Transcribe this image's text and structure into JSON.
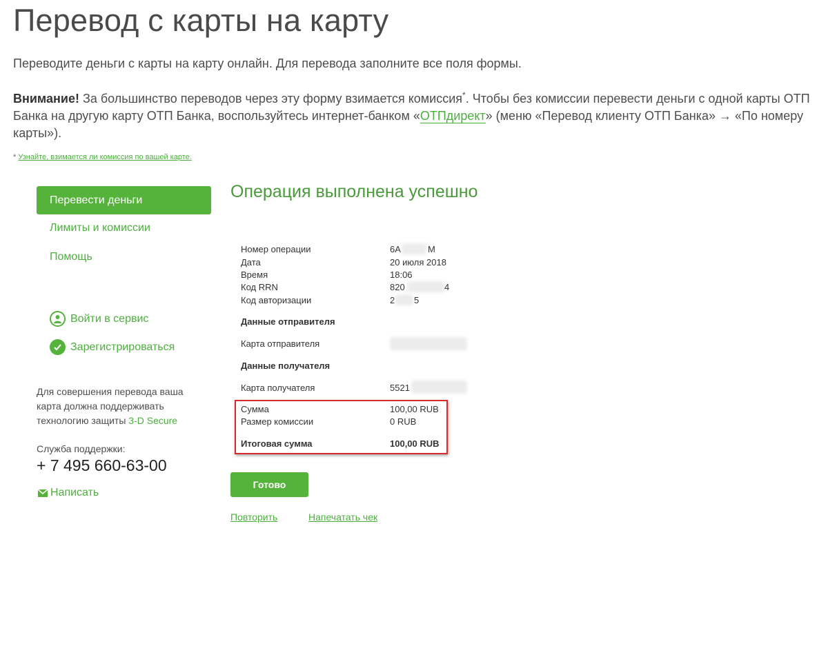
{
  "header": {
    "title": "Перевод с карты на карту",
    "intro": "Переводите деньги с карты на карту онлайн. Для перевода заполните все поля формы.",
    "notice_bold": "Внимание!",
    "notice_part1": " За большинство переводов через эту форму взимается комиссия",
    "notice_sup": "*",
    "notice_part2": ". Чтобы без комиссии перевести деньги с одной карты ОТП Банка на другую карту ОТП Банка, воспользуйтесь интернет-банком «",
    "notice_link": "ОТПдирект",
    "notice_part3": "» (меню «Перевод клиенту ОТП Банка» → «По номеру карты»).",
    "footnote_star": "*",
    "footnote_link": "Узнайте, взимается ли комиссия по вашей карте."
  },
  "sidebar": {
    "items": [
      {
        "label": "Перевести деньги"
      },
      {
        "label": "Лимиты и комиссии"
      },
      {
        "label": "Помощь"
      }
    ],
    "login": "Войти в сервис",
    "register": "Зарегистрироваться",
    "secure_text": "Для совершения перевода ваша карта должна поддерживать технологию защиты",
    "secure_link": "3-D Secure",
    "support_label": "Служба поддержки:",
    "phone": "+ 7 495 660-63-00",
    "write": "Написать"
  },
  "result": {
    "title": "Операция выполнена успешно",
    "op_number_label": "Номер операции",
    "op_number_start": "6A",
    "op_number_end": "M",
    "date_label": "Дата",
    "date": "20 июля 2018",
    "time_label": "Время",
    "time": "18:06",
    "rrn_label": "Код RRN",
    "rrn_start": "820",
    "rrn_end": "4",
    "auth_label": "Код авторизации",
    "auth_start": "2",
    "auth_end": "5",
    "sender_section": "Данные отправителя",
    "sender_card_label": "Карта отправителя",
    "recipient_section": "Данные получателя",
    "recipient_card_label": "Карта получателя",
    "recipient_card_start": "5521",
    "amount_label": "Сумма",
    "amount": "100,00 RUB",
    "fee_label": "Размер комиссии",
    "fee": "0 RUB",
    "total_label": "Итоговая сумма",
    "total": "100,00 RUB"
  },
  "actions": {
    "done": "Готово",
    "repeat": "Повторить",
    "print": "Напечатать чек"
  },
  "colors": {
    "accent": "#55b33c",
    "link": "#4caf3e",
    "highlight": "#d82a2a"
  }
}
